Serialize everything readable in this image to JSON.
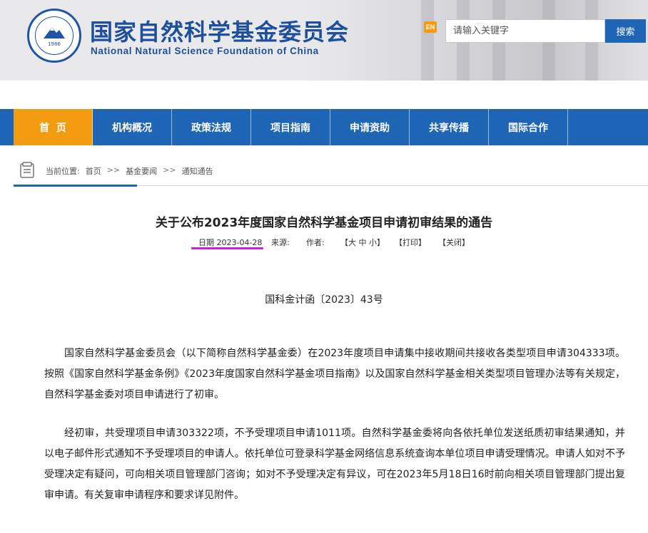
{
  "header": {
    "logo_year": "1986",
    "cn_title": "国家自然科学基金委员会",
    "en_title": "National Natural Science Foundation of China",
    "en_switch": "EN",
    "search_placeholder": "请输入关键字",
    "search_button": "搜索"
  },
  "nav": {
    "items": [
      {
        "label": "首  页",
        "active": true
      },
      {
        "label": "机构概况"
      },
      {
        "label": "政策法规"
      },
      {
        "label": "项目指南"
      },
      {
        "label": "申请资助"
      },
      {
        "label": "共享传播"
      },
      {
        "label": "国际合作"
      }
    ]
  },
  "breadcrumb": {
    "prefix": "当前位置:",
    "items": [
      "首页",
      "基金要闻",
      "通知通告"
    ],
    "separator": ">>"
  },
  "article": {
    "title": "关于公布2023年度国家自然科学基金项目申请初审结果的通告",
    "meta": {
      "date": "日期 2023-04-28",
      "source_label": "来源:",
      "author_label": "作者:",
      "font_size": "【大 中 小】",
      "print": "【打印】",
      "close": "【关闭】"
    },
    "doc_number": "国科金计函〔2023〕43号",
    "paragraphs": [
      "国家自然科学基金委员会（以下简称自然科学基金委）在2023年度项目申请集中接收期间共接收各类型项目申请304333项。按照《国家自然科学基金条例》《2023年度国家自然科学基金项目指南》以及国家自然科学基金相关类型项目管理办法等有关规定，自然科学基金委对项目申请进行了初审。",
      "经初审，共受理项目申请303322项，不予受理项目申请1011项。自然科学基金委将向各依托单位发送纸质初审结果通知，并以电子邮件形式通知不予受理项目的申请人。依托单位可登录科学基金网络信息系统查询本单位项目申请受理情况。申请人如对不予受理决定有疑问，可向相关项目管理部门咨询；如对不予受理决定有异议，可在2023年5月18日16时前向相关项目管理部门提出复审申请。有关复审申请程序和要求详见附件。"
    ]
  },
  "colors": {
    "brand_blue": "#1e65b5",
    "nav_active": "#f39c12",
    "title_blue": "#1e4f9c",
    "date_highlight": "#d81bd4"
  }
}
